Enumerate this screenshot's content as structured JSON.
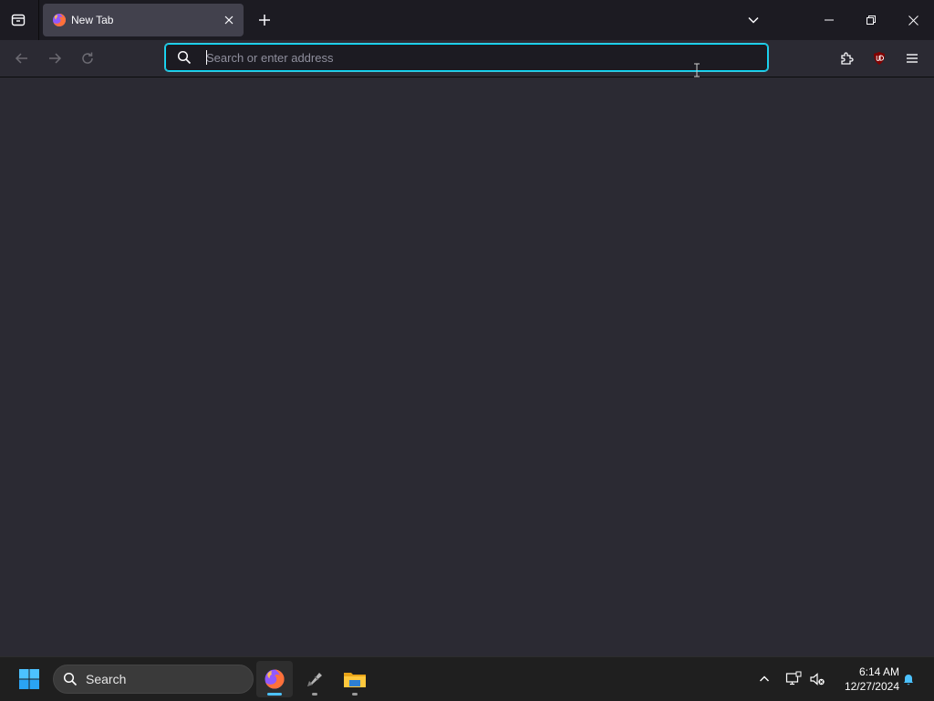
{
  "browser": {
    "tab": {
      "title": "New Tab"
    },
    "urlbar": {
      "placeholder": "Search or enter address",
      "value": ""
    }
  },
  "taskbar": {
    "search_label": "Search",
    "clock": {
      "time": "6:14 AM",
      "date": "12/27/2024"
    },
    "apps": [
      {
        "name": "firefox",
        "icon": "firefox-icon",
        "active": true
      },
      {
        "name": "inkscape",
        "icon": "pen-app-icon",
        "active": false
      },
      {
        "name": "file-explorer",
        "icon": "folder-icon",
        "active": false
      }
    ]
  },
  "colors": {
    "accent": "#00ddff",
    "toolbar_bg": "#2b2a33",
    "tabstrip_bg": "#1c1b22",
    "selected_tab_bg": "#42414d",
    "ublock_red": "#800000"
  }
}
